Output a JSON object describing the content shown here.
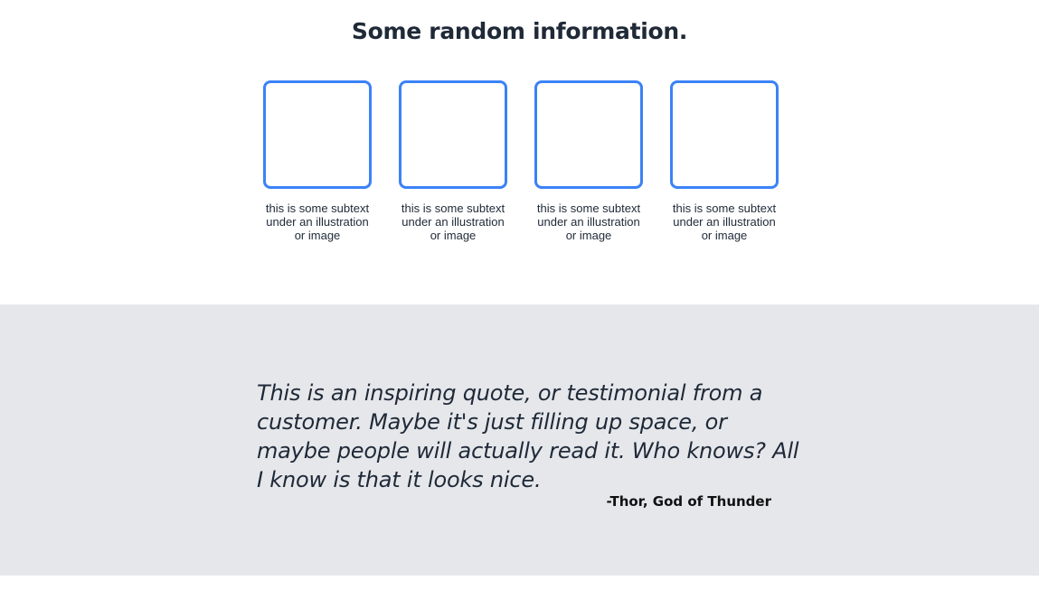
{
  "info": {
    "title": "Some random information.",
    "cards": [
      {
        "caption": "this is some subtext under an illustration or image"
      },
      {
        "caption": "this is some subtext under an illustration or image"
      },
      {
        "caption": "this is some subtext under an illustration or image"
      },
      {
        "caption": "this is some subtext under an illustration or image"
      }
    ]
  },
  "quote": {
    "text": "This is an inspiring quote, or testimonial from a customer. Maybe it's just filling up space, or maybe people will actually read it. Who knows? All I know is that it looks nice.",
    "author": "-Thor, God of Thunder"
  },
  "colors": {
    "card_border": "#3b82f6",
    "quote_background": "#e5e7eb",
    "text": "#1f2937"
  }
}
